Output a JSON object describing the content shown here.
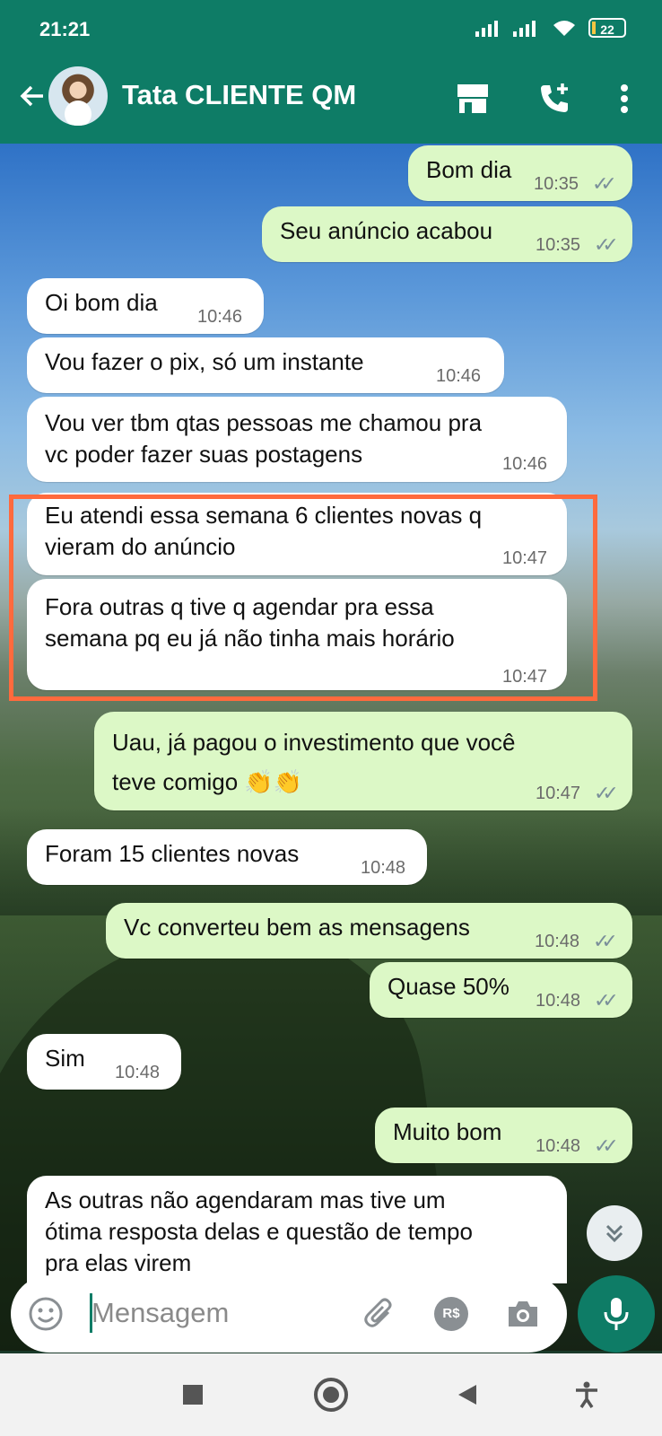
{
  "status": {
    "time": "21:21",
    "battery": "22"
  },
  "header": {
    "contact_name": "Tata CLIENTE QM"
  },
  "messages": [
    {
      "dir": "out",
      "text": "Bom dia",
      "time": "10:35"
    },
    {
      "dir": "out",
      "text": "Seu anúncio acabou",
      "time": "10:35"
    },
    {
      "dir": "in",
      "text": "Oi bom dia",
      "time": "10:46"
    },
    {
      "dir": "in",
      "text": "Vou fazer o pix, só um instante",
      "time": "10:46"
    },
    {
      "dir": "in",
      "text_lines": [
        "Vou ver tbm qtas pessoas me chamou pra",
        "vc poder fazer suas postagens"
      ],
      "time": "10:46"
    },
    {
      "dir": "in",
      "text_lines": [
        "Eu atendi essa semana 6 clientes novas q",
        "vieram do anúncio"
      ],
      "time": "10:47"
    },
    {
      "dir": "in",
      "text_lines": [
        "Fora outras q tive q agendar pra essa",
        "semana pq eu já não tinha mais horário"
      ],
      "time": "10:47"
    },
    {
      "dir": "out",
      "text_lines": [
        "Uau, já pagou o investimento que você",
        "teve comigo 👏👏"
      ],
      "time": "10:47"
    },
    {
      "dir": "in",
      "text": "Foram 15 clientes novas",
      "time": "10:48"
    },
    {
      "dir": "out",
      "text": "Vc converteu bem as mensagens",
      "time": "10:48"
    },
    {
      "dir": "out",
      "text": "Quase 50%",
      "time": "10:48"
    },
    {
      "dir": "in",
      "text": "Sim",
      "time": "10:48"
    },
    {
      "dir": "out",
      "text": "Muito bom",
      "time": "10:48"
    },
    {
      "dir": "in",
      "text_lines": [
        "As outras não agendaram mas tive um",
        "ótima resposta delas e questão de tempo",
        "pra elas virem"
      ]
    }
  ],
  "composer": {
    "placeholder": "Mensagem",
    "currency_label": "R$"
  },
  "colors": {
    "header": "#0e7c66",
    "outgoing_bubble": "#dcf8c6",
    "incoming_bubble": "#ffffff",
    "highlight": "#ff6a3d"
  },
  "icons": [
    "back-arrow-icon",
    "shop-icon",
    "add-call-icon",
    "more-vert-icon",
    "emoji-icon",
    "attach-icon",
    "payment-icon",
    "camera-icon",
    "mic-icon",
    "scroll-down-icon"
  ]
}
